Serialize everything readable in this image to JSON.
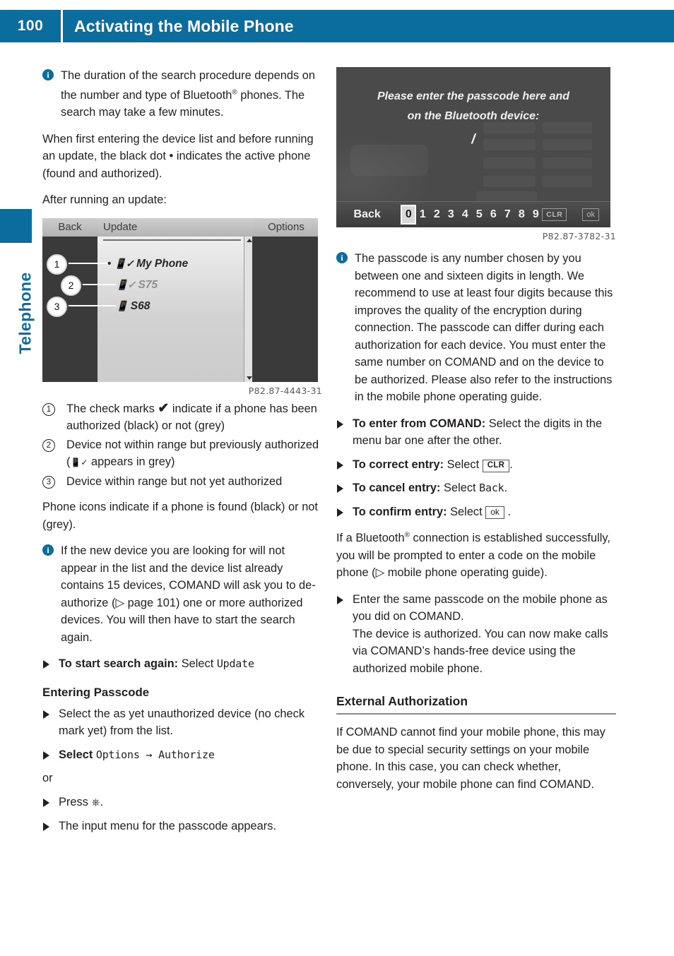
{
  "header": {
    "page_number": "100",
    "title": "Activating the Mobile Phone",
    "accent_color": "#0b6d9d"
  },
  "side_tab": {
    "label": "Telephone"
  },
  "left_column": {
    "note_duration": "The duration of the search procedure depends on the number and type of Bluetooth® phones. The search may take a few minutes.",
    "para_blackdot_1": "When first entering the device list and before running an update, the black dot",
    "para_blackdot_dot": "•",
    "para_blackdot_2": "indicates the active phone (found and authorized).",
    "para_after_update": "After running an update:",
    "figure_devicelist": {
      "back_label": "Back",
      "title_label": "Update",
      "options_label": "Options",
      "rows": [
        {
          "callout": "1",
          "bullet": "•",
          "icon": "phone-check-black-icon",
          "label": "My Phone"
        },
        {
          "callout": "2",
          "bullet": "",
          "icon": "phone-check-grey-icon",
          "label": "S75"
        },
        {
          "callout": "3",
          "bullet": "",
          "icon": "phone-black-icon",
          "label": "S68"
        }
      ],
      "caption": "P82.87-4443-31"
    },
    "legend": [
      {
        "num": "1",
        "text_before": "The check marks",
        "check": "✔",
        "text_after": "indicate if a phone has been authorized (black) or not (grey)"
      },
      {
        "num": "2",
        "text_before": "Device not within range but previously authorized (",
        "check": "",
        "text_after": "appears in grey)"
      },
      {
        "num": "3",
        "text_before": "Device within range but not yet authorized",
        "check": "",
        "text_after": ""
      }
    ],
    "para_phone_icons": "Phone icons indicate if a phone is found (black) or not (grey).",
    "note_new_device_1": "If the new device you are looking for will not appear in the list and the device list already contains 15 devices, COMAND will ask you to de-authorize (",
    "note_new_device_ref": "▷ page 101",
    "note_new_device_2": ") one or more authorized devices. You will then have to start the search again.",
    "step_start_search_bold": "To start search again:",
    "step_start_search_text": "Select",
    "step_start_search_screen": "Update",
    "heading_entering_passcode": "Entering Passcode",
    "step_select_device": "Select the as yet unauthorized device (no check mark yet) from the list.",
    "step_select_options_text": "Select",
    "step_select_options_screen": "Options → Authorize",
    "or_label": "or",
    "step_press_text": "Press",
    "step_press_icon": "controller-press-icon",
    "step_press_suffix": ".",
    "step_input_menu": "The input menu for the passcode appears."
  },
  "right_column": {
    "figure_passcode": {
      "prompt_line1": "Please enter the passcode here and",
      "prompt_line2": "on the Bluetooth device:",
      "cursor": "/",
      "back_label": "Back",
      "digits": [
        "0",
        "1",
        "2",
        "3",
        "4",
        "5",
        "6",
        "7",
        "8",
        "9"
      ],
      "selected_digit": "0",
      "clr_label": "CLR",
      "ok_label": "ok",
      "caption": "P82.87-3782-31"
    },
    "note_passcode": "The passcode is any number chosen by you between one and sixteen digits in length. We recommend to use at least four digits because this improves the quality of the encryption during connection. The passcode can differ during each authorization for each device. You must enter the same number on COMAND and on the device to be authorized. Please also refer to the instructions in the mobile phone operating guide.",
    "step_enter_bold": "To enter from COMAND:",
    "step_enter_text": "Select the digits in the menu bar one after the other.",
    "step_correct_bold": "To correct entry:",
    "step_correct_text": "Select",
    "step_correct_key": "CLR",
    "step_cancel_bold": "To cancel entry:",
    "step_cancel_text": "Select",
    "step_cancel_screen": "Back",
    "step_confirm_bold": "To confirm entry:",
    "step_confirm_text": "Select",
    "step_confirm_key": "ok",
    "para_connection_1": "If a Bluetooth® connection is established successfully, you will be prompted to enter a code on the mobile phone (",
    "para_connection_ref": "▷ mobile phone",
    "para_connection_2": "operating guide).",
    "step_enter_same_passcode": "Enter the same passcode on the mobile phone as you did on COMAND.",
    "step_enter_same_passcode_result": "The device is authorized. You can now make calls via COMAND’s hands-free device using the authorized mobile phone.",
    "heading_external_authorization": "External Authorization",
    "para_external": "If COMAND cannot find your mobile phone, this may be due to special security settings on your mobile phone. In this case, you can check whether, conversely, your mobile phone can find COMAND."
  }
}
